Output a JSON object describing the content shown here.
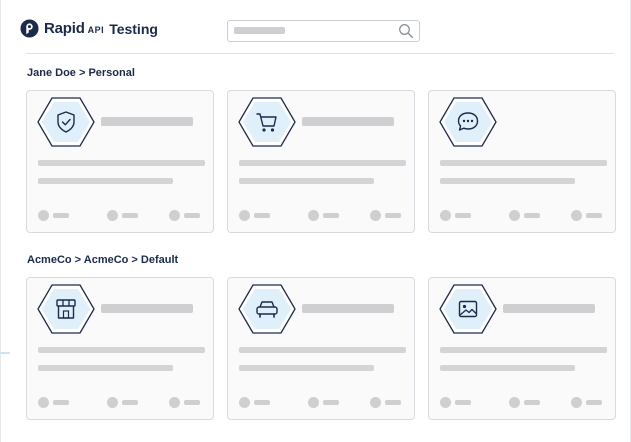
{
  "header": {
    "brand_rapid": "Rapid",
    "brand_api": "API",
    "brand_product": "Testing",
    "search_placeholder_shown": true
  },
  "sections": [
    {
      "path": "Jane Doe > Personal",
      "cards": [
        {
          "icon": "shield-check-icon"
        },
        {
          "icon": "shopping-cart-icon"
        },
        {
          "icon": "chat-bubble-icon"
        }
      ]
    },
    {
      "path": "AcmeCo > AcmeCo > Default",
      "cards": [
        {
          "icon": "storefront-icon"
        },
        {
          "icon": "car-icon"
        },
        {
          "icon": "image-icon"
        }
      ]
    }
  ],
  "colors": {
    "brand_navy": "#1c2b4a",
    "hex_fill": "#dff0fb",
    "skeleton": "#cfcfd2",
    "card_border": "#d7dbe0"
  }
}
